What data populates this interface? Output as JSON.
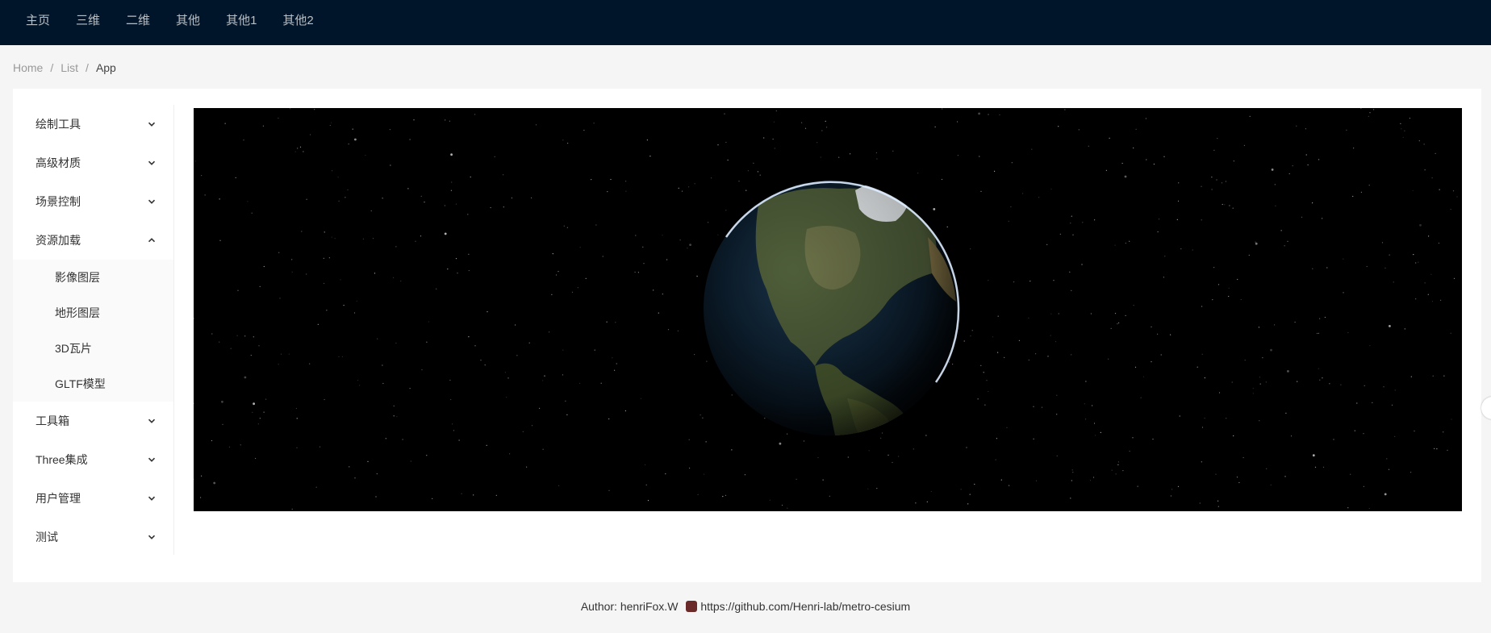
{
  "topnav": {
    "items": [
      "主页",
      "三维",
      "二维",
      "其他",
      "其他1",
      "其他2"
    ]
  },
  "breadcrumb": {
    "items": [
      "Home",
      "List",
      "App"
    ],
    "separator": "/"
  },
  "sidebar": {
    "menu_before": [
      {
        "label": "绘制工具",
        "icon": "chevron-down-icon"
      },
      {
        "label": "高级材质",
        "icon": "chevron-down-icon"
      },
      {
        "label": "场景控制",
        "icon": "chevron-down-icon"
      }
    ],
    "open_menu": {
      "label": "资源加载",
      "icon": "chevron-up-icon"
    },
    "sub_items": [
      "影像图层",
      "地形图层",
      "3D瓦片",
      "GLTF模型"
    ],
    "menu_after": [
      {
        "label": "工具箱",
        "icon": "chevron-down-icon"
      },
      {
        "label": "Three集成",
        "icon": "chevron-down-icon"
      },
      {
        "label": "用户管理",
        "icon": "chevron-down-icon"
      },
      {
        "label": "测试",
        "icon": "chevron-down-icon"
      }
    ]
  },
  "viewer": {
    "content": "globe-view",
    "background_color": "#000000"
  },
  "footer": {
    "author": "Author: henriFox.W",
    "link": "https://github.com/Henri-lab/metro-cesium",
    "icon": "github-icon"
  },
  "colors": {
    "topbar": "#001529",
    "page_bg": "#f5f5f5",
    "submenu_bg": "#fafafa"
  }
}
